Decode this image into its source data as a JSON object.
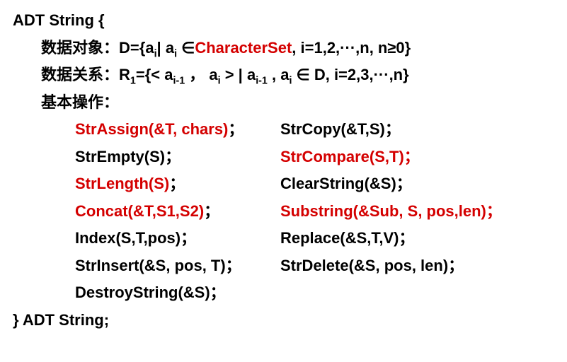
{
  "header": "ADT String {",
  "dataobj_label": "数据对象：",
  "dataobj_eq1": "D={a",
  "dataobj_sub1": "i",
  "dataobj_eq2": "| a",
  "dataobj_sub2": "i",
  "dataobj_in": " ∈",
  "dataobj_charset": "CharacterSet",
  "dataobj_tail": ", i=1,2,···,n, n≥0}",
  "datarel_label": "数据关系：",
  "datarel_eq1": "R",
  "datarel_subR": "1",
  "datarel_eq2": "={< a",
  "datarel_sub_im1a": "i-1",
  "datarel_eq3": " ， a",
  "datarel_sub_i1": "i",
  "datarel_eq4": " > |  a",
  "datarel_sub_im1b": "i-1",
  "datarel_eq5": " , a",
  "datarel_sub_i2": "i",
  "datarel_eq6": " ∈ D,   i=2,3,···,n}",
  "ops_label": "基本操作：",
  "ops": {
    "strassign": "StrAssign(&T, chars)",
    "strcopy": "StrCopy(&T,S)；",
    "strempty": "StrEmpty(S)；",
    "strcompare": "StrCompare(S,T)；",
    "strlength": "StrLength(S)",
    "clearstring": "ClearString(&S)；",
    "concat": "Concat(&T,S1,S2)",
    "substring": "Substring(&Sub, S, pos,len)；",
    "index": "Index(S,T,pos)；",
    "replace": "Replace(&S,T,V)；",
    "strinsert": "StrInsert(&S, pos, T)；",
    "strdelete": "StrDelete(&S, pos, len)；",
    "destroystring": "DestroyString(&S)；"
  },
  "semicolon_full": "；",
  "footer": "}   ADT String;"
}
